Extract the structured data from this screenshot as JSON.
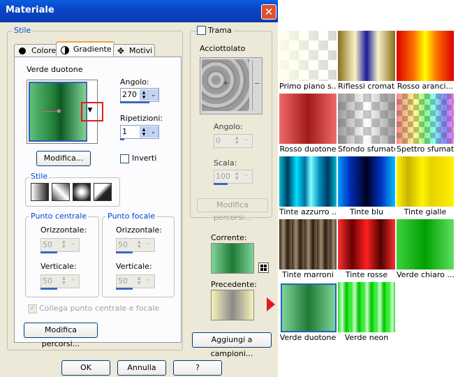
{
  "window": {
    "title": "Materiale"
  },
  "stile": {
    "legend": "Stile",
    "tabs": [
      {
        "label": "Colore"
      },
      {
        "label": "Gradiente"
      },
      {
        "label": "Motivi"
      }
    ],
    "gradient_name": "Verde duotone",
    "angle_label": "Angolo:",
    "angle_value": "270",
    "repeat_label": "Ripetizioni:",
    "repeat_value": "1",
    "modify_button": "Modifica...",
    "invert_label": "Inverti",
    "style_legend": "Stile",
    "center_legend": "Punto centrale",
    "focal_legend": "Punto focale",
    "horizontal_label": "Orizzontale:",
    "vertical_label": "Verticale:",
    "center_h": "50",
    "center_v": "50",
    "focal_h": "50",
    "focal_v": "50",
    "link_label": "Collega punto centrale e focale",
    "modify_paths_button": "Modifica percorsi..."
  },
  "trama": {
    "label": "Trama",
    "texture_name": "Acciottolato",
    "angle_label": "Angolo:",
    "angle_value": "0",
    "scale_label": "Scala:",
    "scale_value": "100",
    "modify_paths_button": "Modifica percorsi..."
  },
  "preview": {
    "current_label": "Corrente:",
    "previous_label": "Precedente:",
    "add_button": "Aggiungi a campioni..."
  },
  "footer": {
    "ok": "OK",
    "cancel": "Annulla",
    "help": "?"
  },
  "gallery": {
    "items": [
      {
        "label": "Primo piano s..."
      },
      {
        "label": "Riflessi cromati"
      },
      {
        "label": "Rosso aranci..."
      },
      {
        "label": "Rosso duotone"
      },
      {
        "label": "Sfondo sfumato"
      },
      {
        "label": "Spettro sfumato"
      },
      {
        "label": "Tinte azzurro ..."
      },
      {
        "label": "Tinte blu"
      },
      {
        "label": "Tinte gialle"
      },
      {
        "label": "Tinte marroni"
      },
      {
        "label": "Tinte rosse"
      },
      {
        "label": "Verde chiaro ..."
      },
      {
        "label": "Verde duotone"
      },
      {
        "label": "Verde neon"
      }
    ]
  },
  "colors": {
    "accent": "#0a45c8",
    "highlight": "#e8181c",
    "selected_border": "#2b5fbf"
  }
}
